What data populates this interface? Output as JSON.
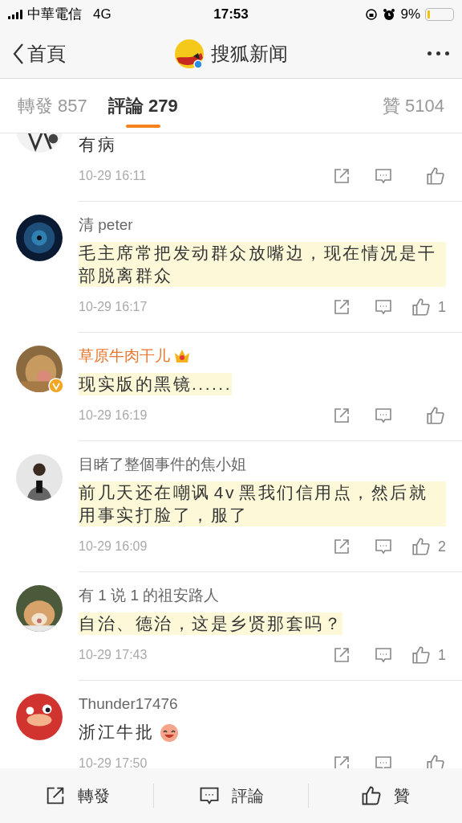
{
  "status_bar": {
    "carrier": "中華電信",
    "network": "4G",
    "time": "17:53",
    "battery": "9%"
  },
  "nav": {
    "back": "首頁",
    "title": "搜狐新闻"
  },
  "tabs": [
    {
      "label": "轉發 857",
      "selected": false
    },
    {
      "label": "評論 279",
      "selected": true
    },
    {
      "label": "贊 5104",
      "selected": false
    }
  ],
  "comments": [
    {
      "text": "有病",
      "time": "10-29 16:11",
      "highlighted": false,
      "verified": false
    },
    {
      "name": "清 peter",
      "text": "毛主席常把发动群众放嘴边，现在情况是干部脱离群众",
      "time": "10-29 16:17",
      "likes": "1",
      "highlighted": true,
      "vip": false,
      "verified": false
    },
    {
      "name": "草原牛肉干儿",
      "text": "现实版的黑镜......",
      "time": "10-29 16:19",
      "highlighted": true,
      "vip": true,
      "verified": true
    },
    {
      "name": "目睹了整個事件的焦小姐",
      "text": "前几天还在嘲讽 4v 黑我们信用点，然后就用事实打脸了，服了",
      "time": "10-29 16:09",
      "likes": "2",
      "highlighted": true,
      "vip": false,
      "verified": false
    },
    {
      "name": "有 1 说 1 的祖安路人",
      "text": "自治、德治，这是乡贤那套吗？",
      "time": "10-29 17:43",
      "likes": "1",
      "highlighted": true,
      "vip": false,
      "verified": false
    },
    {
      "name": "Thunder17476",
      "text": "浙江牛批",
      "time": "10-29 17:50",
      "highlighted": false,
      "vip": false,
      "verified": false,
      "emoji": true
    }
  ],
  "bottom_bar": [
    {
      "label": "轉發",
      "kind": "share"
    },
    {
      "label": "評論",
      "kind": "comment"
    },
    {
      "label": "贊",
      "kind": "like"
    }
  ]
}
